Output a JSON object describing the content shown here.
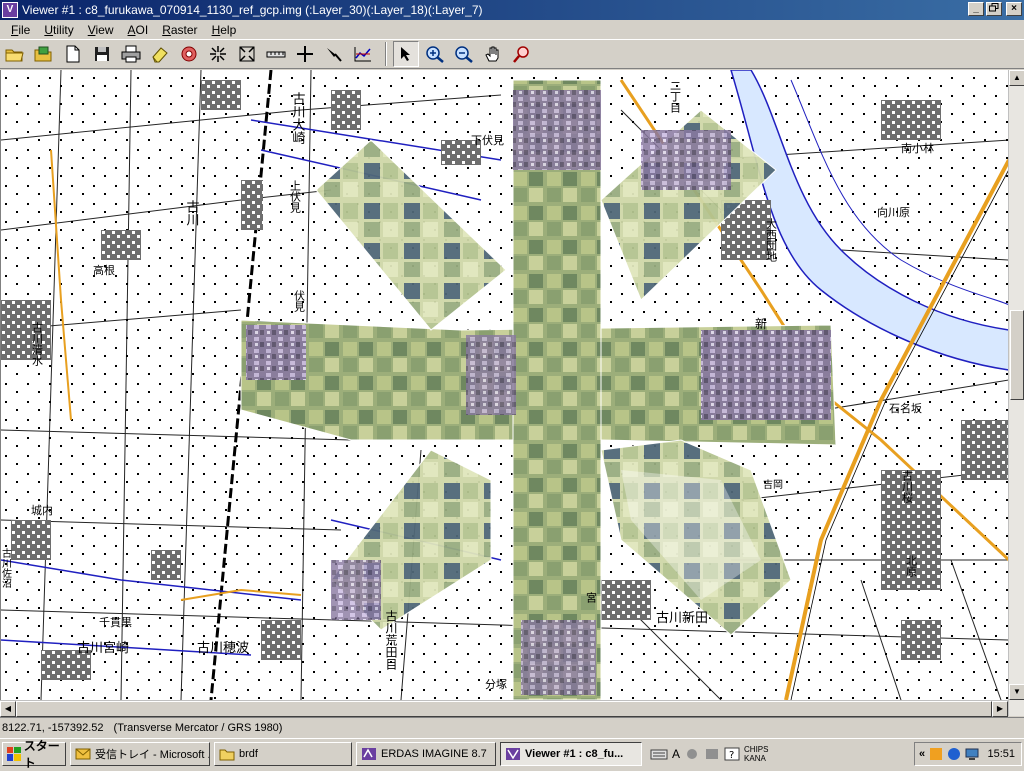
{
  "window": {
    "app_icon": "erdas-viewer-icon",
    "title": "Viewer #1 : c8_furukawa_070914_1130_ref_gcp.img (:Layer_30)(:Layer_18)(:Layer_7)",
    "controls": {
      "minimize": "_",
      "maximize": "▫",
      "close": "×"
    }
  },
  "menu": {
    "items": [
      {
        "label": "File",
        "key": "F",
        "rest": "ile"
      },
      {
        "label": "Utility",
        "key": "U",
        "rest": "tility"
      },
      {
        "label": "View",
        "key": "V",
        "rest": "iew"
      },
      {
        "label": "AOI",
        "key": "A",
        "rest": "OI"
      },
      {
        "label": "Raster",
        "key": "R",
        "rest": "aster"
      },
      {
        "label": "Help",
        "key": "H",
        "rest": "elp"
      }
    ]
  },
  "toolbar": {
    "tools": [
      "open-folder-icon",
      "open-layer-icon",
      "new-document-icon",
      "save-icon",
      "print-icon",
      "eraser-icon",
      "target-icon",
      "zoom-in-fixed-icon",
      "zoom-out-fixed-icon",
      "measure-icon",
      "inquire-cursor-icon",
      "tool-palette-icon",
      "profile-icon"
    ],
    "tools2": [
      "select-arrow-icon",
      "zoom-in-icon",
      "zoom-out-icon",
      "pan-hand-icon",
      "link-zoom-icon"
    ]
  },
  "map": {
    "labels": [
      "古川大崎",
      "古川",
      "古川清水",
      "下伏見",
      "伏見",
      "上伏見",
      "古川",
      "高根",
      "南小林",
      "向川原",
      "大西団地",
      "新",
      "石名坂",
      "古川新田",
      "千貫黒",
      "古川穂波",
      "古川荒田目",
      "古川宮崎",
      "古川桜",
      "北原",
      "分塚",
      "宮",
      "城内",
      "二丁目",
      "吉岡",
      "古川佐沼"
    ]
  },
  "status": {
    "coords": "8122.71, -157392.52",
    "projection": "(Transverse Mercator / GRS 1980)"
  },
  "taskbar": {
    "start_label": "スタート",
    "tasks": [
      {
        "label": "受信トレイ - Microsoft ...",
        "icon": "outlook-icon",
        "active": false
      },
      {
        "label": "brdf",
        "icon": "folder-icon",
        "active": false
      },
      {
        "label": "ERDAS IMAGINE 8.7",
        "icon": "erdas-icon",
        "active": false
      },
      {
        "label": "Viewer #1 : c8_fu...",
        "icon": "viewer-icon",
        "active": true
      }
    ],
    "ime": {
      "mode": "A",
      "chips": "CHIPS",
      "kana": "KANA"
    },
    "clock": "15:51"
  }
}
